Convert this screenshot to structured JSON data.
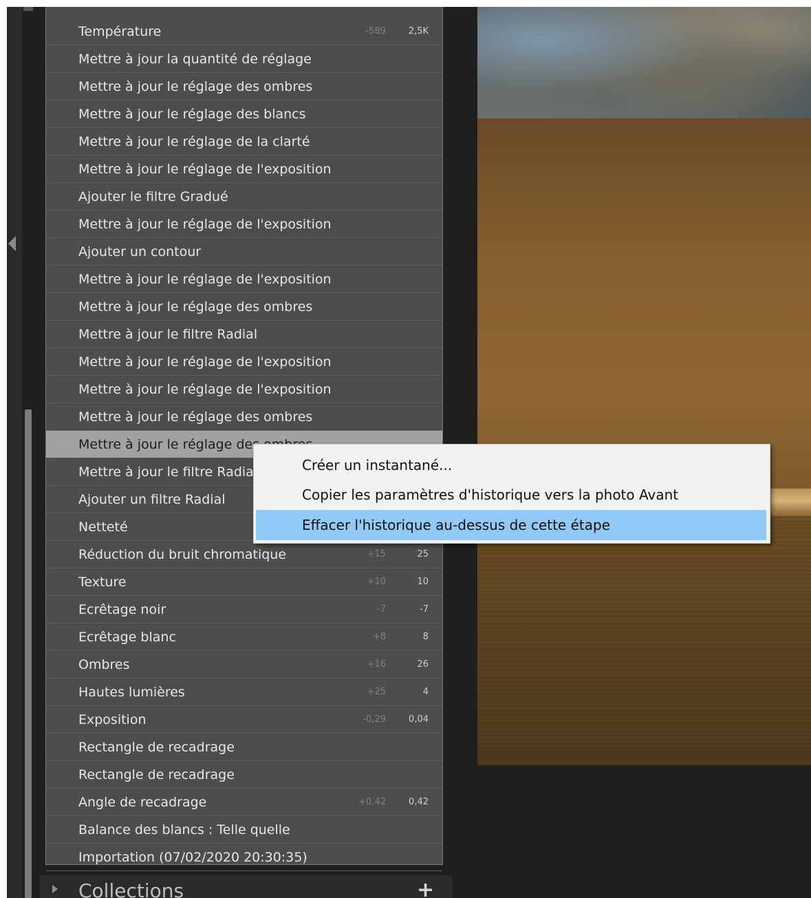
{
  "history": {
    "items": [
      {
        "label": "Température",
        "delta": "-589",
        "value": "2,5K"
      },
      {
        "label": "Mettre à jour la quantité de réglage",
        "delta": "",
        "value": ""
      },
      {
        "label": "Mettre à jour le réglage des ombres",
        "delta": "",
        "value": ""
      },
      {
        "label": "Mettre à jour le réglage des blancs",
        "delta": "",
        "value": ""
      },
      {
        "label": "Mettre à jour le réglage de la clarté",
        "delta": "",
        "value": ""
      },
      {
        "label": "Mettre à jour le réglage de l'exposition",
        "delta": "",
        "value": ""
      },
      {
        "label": "Ajouter le filtre Gradué",
        "delta": "",
        "value": ""
      },
      {
        "label": "Mettre à jour le réglage de l'exposition",
        "delta": "",
        "value": ""
      },
      {
        "label": "Ajouter un contour",
        "delta": "",
        "value": ""
      },
      {
        "label": "Mettre à jour le réglage de l'exposition",
        "delta": "",
        "value": ""
      },
      {
        "label": "Mettre à jour le réglage des ombres",
        "delta": "",
        "value": ""
      },
      {
        "label": "Mettre à jour le filtre Radial",
        "delta": "",
        "value": ""
      },
      {
        "label": "Mettre à jour le réglage de l'exposition",
        "delta": "",
        "value": ""
      },
      {
        "label": "Mettre à jour le réglage de l'exposition",
        "delta": "",
        "value": ""
      },
      {
        "label": "Mettre à jour le réglage des ombres",
        "delta": "",
        "value": ""
      },
      {
        "label": "Mettre à jour le réglage des ombres",
        "delta": "",
        "value": ""
      },
      {
        "label": "Mettre à jour le filtre Radial",
        "delta": "",
        "value": ""
      },
      {
        "label": "Ajouter un filtre Radial",
        "delta": "",
        "value": ""
      },
      {
        "label": "Netteté",
        "delta": "",
        "value": ""
      },
      {
        "label": "Réduction du bruit chromatique",
        "delta": "+15",
        "value": "25"
      },
      {
        "label": "Texture",
        "delta": "+10",
        "value": "10"
      },
      {
        "label": "Ecrêtage noir",
        "delta": "-7",
        "value": "-7"
      },
      {
        "label": "Ecrêtage blanc",
        "delta": "+8",
        "value": "8"
      },
      {
        "label": "Ombres",
        "delta": "+16",
        "value": "26"
      },
      {
        "label": "Hautes lumières",
        "delta": "+25",
        "value": "4"
      },
      {
        "label": "Exposition",
        "delta": "-0,29",
        "value": "0,04"
      },
      {
        "label": "Rectangle de recadrage",
        "delta": "",
        "value": ""
      },
      {
        "label": "Rectangle de recadrage",
        "delta": "",
        "value": ""
      },
      {
        "label": "Angle de recadrage",
        "delta": "+0,42",
        "value": "0,42"
      },
      {
        "label": "Balance des blancs : Telle quelle",
        "delta": "",
        "value": ""
      },
      {
        "label": "Importation (07/02/2020 20:30:35)",
        "delta": "",
        "value": ""
      }
    ]
  },
  "context_menu": {
    "items": [
      {
        "label": "Créer un instantané..."
      },
      {
        "label": "Copier les paramètres d'historique vers la photo Avant"
      },
      {
        "label": "Effacer l'historique au-dessus de cette étape"
      }
    ]
  },
  "collections": {
    "label": "Collections",
    "add_symbol": "+"
  }
}
